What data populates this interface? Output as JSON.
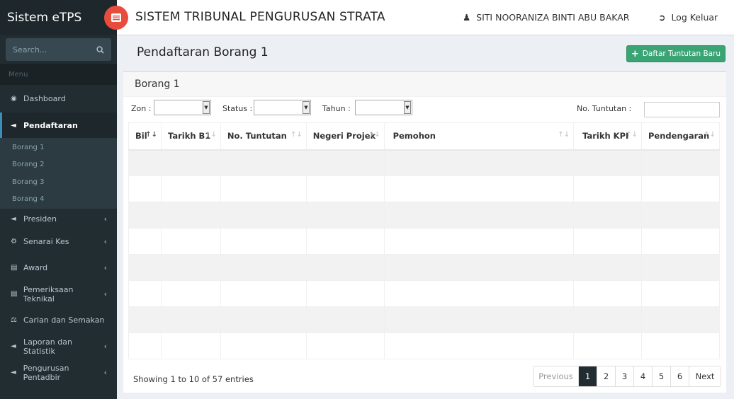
{
  "brand": "Sistem eTPS",
  "search": {
    "placeholder": "Search..."
  },
  "menu": {
    "header": "Menu",
    "items": [
      {
        "label": "Dashboard",
        "icon": "dashboard-icon"
      },
      {
        "label": "Pendaftaran",
        "icon": "bullhorn-icon"
      },
      {
        "label": "Presiden",
        "icon": "bullhorn-icon"
      },
      {
        "label": "Senarai Kes",
        "icon": "cogs-icon"
      },
      {
        "label": "Award",
        "icon": "bar-chart-icon"
      },
      {
        "label": "Pemeriksaan Teknikal",
        "icon": "bar-chart-icon"
      },
      {
        "label": "Carian dan Semakan",
        "icon": "balance-scale-icon"
      },
      {
        "label": "Laporan dan Statistik",
        "icon": "bullhorn-icon"
      },
      {
        "label": "Pengurusan Pentadbir",
        "icon": "bullhorn-icon"
      }
    ],
    "submenu": [
      "Borang 1",
      "Borang 2",
      "Borang 3",
      "Borang 4"
    ]
  },
  "topbar": {
    "title": "SISTEM TRIBUNAL PENGURUSAN STRATA",
    "user": "SITI NOORANIZA BINTI ABU BAKAR",
    "logout": "Log Keluar"
  },
  "page": {
    "title": "Pendaftaran Borang 1",
    "add_button": "Daftar Tuntutan Baru"
  },
  "box": {
    "title": "Borang 1",
    "filters": {
      "zon": "Zon :",
      "status": "Status :",
      "tahun": "Tahun :",
      "no_tuntutan": "No. Tuntutan :"
    },
    "columns": [
      "Bil",
      "Tarikh B1",
      "No. Tuntutan",
      "Negeri Projek",
      "Pemohon",
      "Tarikh KPI",
      "Pendengaran"
    ],
    "info": "Showing 1 to 10 of 57 entries",
    "pagination": {
      "previous": "Previous",
      "pages": [
        "1",
        "2",
        "3",
        "4",
        "5",
        "6"
      ],
      "next": "Next",
      "active": "1"
    }
  },
  "colors": {
    "sidebar": "#222d32",
    "accent": "#3c8dbc",
    "add_button": "#3aa474",
    "toggle": "#e74c3c"
  }
}
